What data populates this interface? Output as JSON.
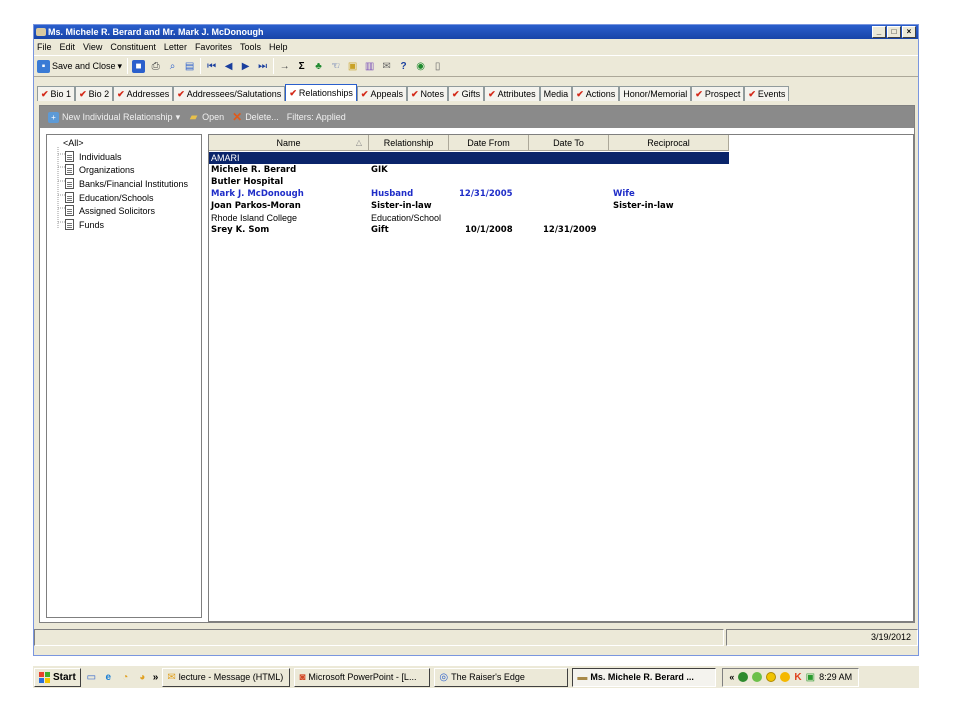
{
  "window": {
    "title": "Ms. Michele R. Berard and Mr. Mark J. McDonough"
  },
  "menu": [
    "File",
    "Edit",
    "View",
    "Constituent",
    "Letter",
    "Favorites",
    "Tools",
    "Help"
  ],
  "toolbar": {
    "save_close": "Save and Close"
  },
  "tabs": [
    {
      "label": "Bio 1",
      "check": true
    },
    {
      "label": "Bio 2",
      "check": true
    },
    {
      "label": "Addresses",
      "check": true
    },
    {
      "label": "Addressees/Salutations",
      "check": true
    },
    {
      "label": "Relationships",
      "check": true,
      "active": true
    },
    {
      "label": "Appeals",
      "check": true
    },
    {
      "label": "Notes",
      "check": true
    },
    {
      "label": "Gifts",
      "check": true
    },
    {
      "label": "Attributes",
      "check": true
    },
    {
      "label": "Media",
      "check": false
    },
    {
      "label": "Actions",
      "check": true
    },
    {
      "label": "Honor/Memorial",
      "check": false
    },
    {
      "label": "Prospect",
      "check": true
    },
    {
      "label": "Events",
      "check": true
    }
  ],
  "subbar": {
    "new_rel": "New Individual Relationship",
    "open": "Open",
    "delete": "Delete...",
    "filters": "Filters: Applied"
  },
  "tree": {
    "root": "<All>",
    "items": [
      "Individuals",
      "Organizations",
      "Banks/Financial Institutions",
      "Education/Schools",
      "Assigned Solicitors",
      "Funds"
    ]
  },
  "grid": {
    "columns": [
      "Name",
      "Relationship",
      "Date From",
      "Date To",
      "Reciprocal"
    ],
    "rows": [
      {
        "name": "AMARI",
        "relationship": "",
        "date_from": "",
        "date_to": "",
        "reciprocal": "",
        "selected": true
      },
      {
        "name": "Michele R. Berard",
        "relationship": "GIK",
        "date_from": "",
        "date_to": "",
        "reciprocal": "",
        "bold": true
      },
      {
        "name": "Butler Hospital",
        "relationship": "",
        "date_from": "",
        "date_to": "",
        "reciprocal": "",
        "bold": true
      },
      {
        "name": "Mark J. McDonough",
        "relationship": "Husband",
        "date_from": "12/31/2005",
        "date_to": "",
        "reciprocal": "Wife",
        "bold": true,
        "blue": true
      },
      {
        "name": "Joan Parkos-Moran",
        "relationship": "Sister-in-law",
        "date_from": "",
        "date_to": "",
        "reciprocal": "Sister-in-law",
        "bold": true
      },
      {
        "name": "Rhode Island College",
        "relationship": "Education/School",
        "date_from": "",
        "date_to": "",
        "reciprocal": ""
      },
      {
        "name": "Srey K. Som",
        "relationship": "Gift",
        "date_from": "10/1/2008",
        "date_to": "12/31/2009",
        "reciprocal": "",
        "bold": true
      }
    ]
  },
  "status": {
    "date": "3/19/2012"
  },
  "taskbar": {
    "start": "Start",
    "tasks": [
      "lecture - Message (HTML)",
      "Microsoft PowerPoint - [L...",
      "The Raiser's Edge",
      "Ms. Michele R. Berard ..."
    ],
    "clock": "8:29 AM"
  },
  "colors": {
    "selection": "#0a246a",
    "spouse_text": "#1f2dc8",
    "check": "#d42a1a"
  }
}
